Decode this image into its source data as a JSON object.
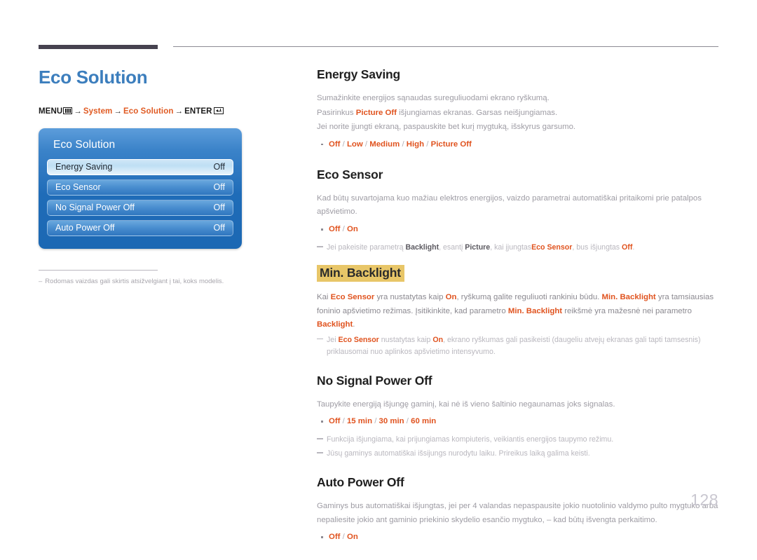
{
  "page": {
    "title": "Eco Solution",
    "number": "128"
  },
  "breadcrumb": {
    "menu_label": "MENU",
    "menu_icon": "menu-bars-icon",
    "arrow": "→",
    "item1": "System",
    "item2": "Eco Solution",
    "enter_label": "ENTER",
    "enter_icon": "enter-return-icon"
  },
  "osd": {
    "title": "Eco Solution",
    "rows": [
      {
        "label": "Energy Saving",
        "value": "Off",
        "selected": true
      },
      {
        "label": "Eco Sensor",
        "value": "Off",
        "selected": false
      },
      {
        "label": "No Signal Power Off",
        "value": "Off",
        "selected": false
      },
      {
        "label": "Auto Power Off",
        "value": "Off",
        "selected": false
      }
    ]
  },
  "left_note": {
    "dash": "–",
    "text": "Rodomas vaizdas gali skirtis atsižvelgiant į tai, koks modelis."
  },
  "sections": {
    "energy_saving": {
      "heading": "Energy Saving",
      "p1": "Sumažinkite energijos sąnaudas sureguliuodami ekrano ryškumą.",
      "p2_a": "Pasirinkus ",
      "p2_kw": "Picture Off",
      "p2_b": " išjungiamas ekranas. Garsas neišjungiamas.",
      "p3": "Jei norite įjungti ekraną, paspauskite bet kurį mygtuką, išskyrus garsumo.",
      "options": [
        "Off",
        "Low",
        "Medium",
        "High",
        "Picture Off"
      ]
    },
    "eco_sensor": {
      "heading": "Eco Sensor",
      "p1": "Kad būtų suvartojama kuo mažiau elektros energijos, vaizdo parametrai automatiškai pritaikomi prie patalpos apšvietimo.",
      "options": [
        "Off",
        "On"
      ],
      "note_a": "Jei pakeisite parametrą ",
      "note_kw1": "Backlight",
      "note_b": ", esantį ",
      "note_kw2": "Picture",
      "note_c": ", kai įjungtas",
      "note_kw3": "Eco Sensor",
      "note_d": ", bus išjungtas ",
      "note_kw4": "Off",
      "note_e": "."
    },
    "min_backlight": {
      "heading": "Min. Backlight",
      "p_a": "Kai ",
      "p_kw1": "Eco Sensor",
      "p_b": " yra nustatytas kaip ",
      "p_kw2": "On",
      "p_c": ", ryškumą galite reguliuoti rankiniu būdu. ",
      "p_kw3": "Min. Backlight",
      "p_d": " yra tamsiausias foninio apšvietimo režimas. Įsitikinkite, kad parametro ",
      "p_kw4": "Min. Backlight",
      "p_e": " reikšmė yra mažesnė nei parametro ",
      "p_kw5": "Backlight",
      "p_f": ".",
      "note_a": "Jei ",
      "note_kw1": "Eco Sensor",
      "note_b": " nustatytas kaip ",
      "note_kw2": "On",
      "note_c": ", ekrano ryškumas gali pasikeisti (daugeliu atvejų ekranas gali tapti tamsesnis) priklausomai nuo aplinkos apšvietimo intensyvumo."
    },
    "no_signal_power_off": {
      "heading": "No Signal Power Off",
      "p1": "Taupykite energiją išjungę gaminį, kai nė iš vieno šaltinio negaunamas joks signalas.",
      "options": [
        "Off",
        "15 min",
        "30 min",
        "60 min"
      ],
      "note1": "Funkcija išjungiama, kai prijungiamas kompiuteris, veikiantis energijos taupymo režimu.",
      "note2": "Jūsų gaminys automatiškai išsijungs nurodytu laiku. Prireikus laiką galima keisti."
    },
    "auto_power_off": {
      "heading": "Auto Power Off",
      "p1": "Gaminys bus automatiškai išjungtas, jei per 4 valandas nepaspausite jokio nuotolinio valdymo pulto mygtuko arba nepaliesite jokio ant gaminio priekinio skydelio esančio mygtuko, – kad būtų išvengta perkaitimo.",
      "options": [
        "Off",
        "On"
      ]
    }
  },
  "colors": {
    "title_blue": "#3c7ebd",
    "keyword_orange": "#e0531f",
    "highlight_yellow": "#e8c668",
    "osd_blue": "#1f6cb8",
    "rule_dark": "#46424f"
  }
}
